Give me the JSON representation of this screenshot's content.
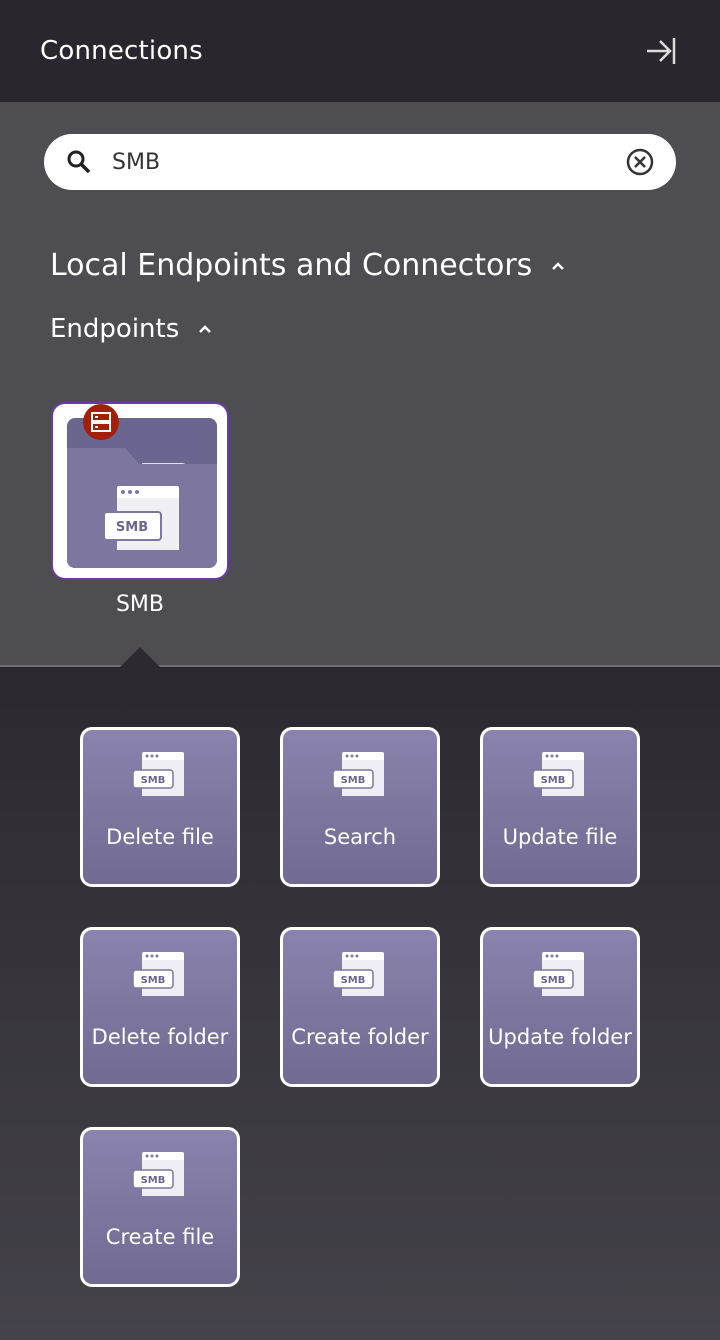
{
  "header": {
    "title": "Connections",
    "collapse_icon": "collapse-right-icon"
  },
  "search": {
    "value": "SMB",
    "search_icon": "search-icon",
    "clear_icon": "clear-circle-icon"
  },
  "sections": {
    "local": "Local Endpoints and Connectors",
    "endpoints": "Endpoints"
  },
  "endpoint": {
    "label": "SMB",
    "icon_text": "SMB",
    "badge_icon": "server-icon"
  },
  "activities": [
    {
      "label": "Delete file"
    },
    {
      "label": "Search"
    },
    {
      "label": "Update file"
    },
    {
      "label": "Delete folder"
    },
    {
      "label": "Create folder"
    },
    {
      "label": "Update folder"
    },
    {
      "label": "Create file"
    }
  ],
  "colors": {
    "header": "#29272d",
    "panel": "#4e4d52",
    "tile": "#7d77a0",
    "badge": "#a31f0a",
    "accent": "#6a3ba0"
  }
}
